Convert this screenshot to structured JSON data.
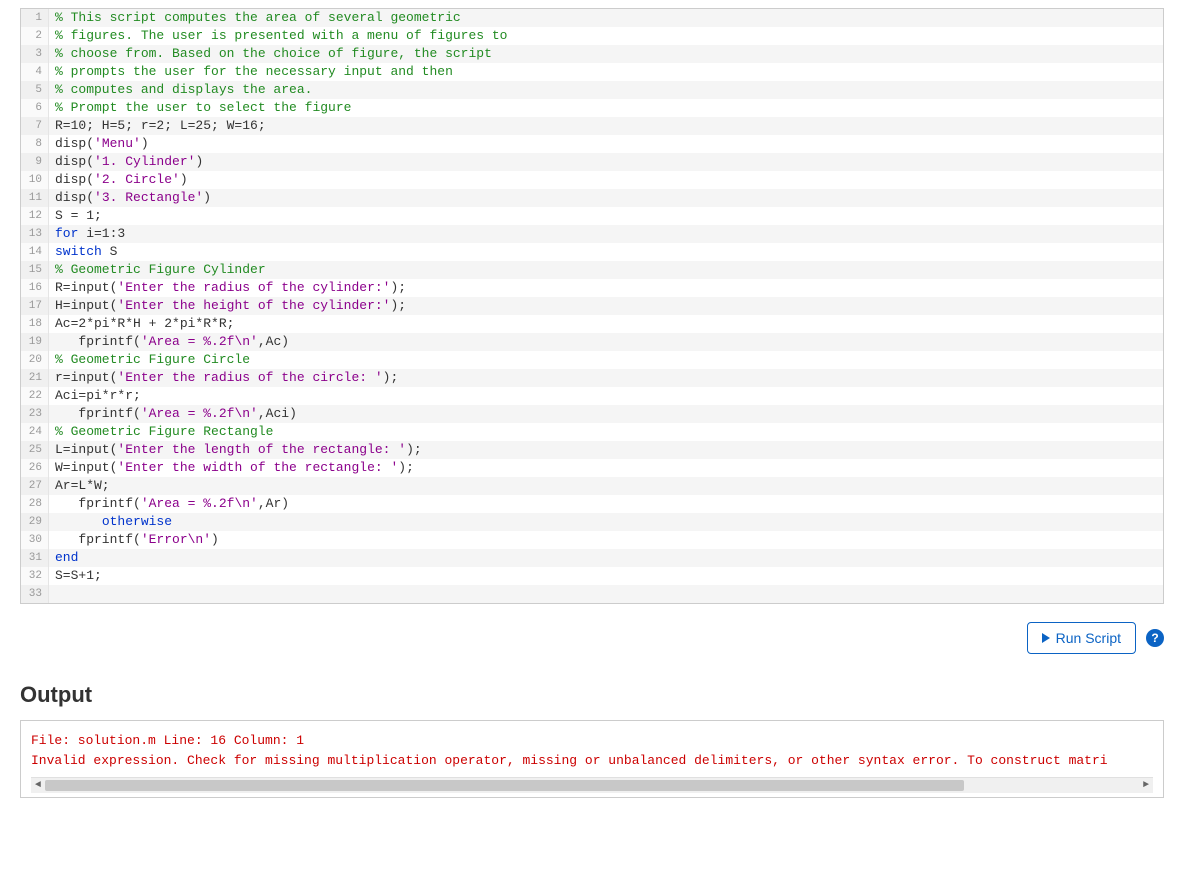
{
  "editor": {
    "lines": [
      {
        "num": 1,
        "tokens": [
          {
            "t": "comment",
            "v": "% This script computes the area of several geometric"
          }
        ]
      },
      {
        "num": 2,
        "tokens": [
          {
            "t": "comment",
            "v": "% figures. The user is presented with a menu of figures to"
          }
        ]
      },
      {
        "num": 3,
        "tokens": [
          {
            "t": "comment",
            "v": "% choose from. Based on the choice of figure, the script"
          }
        ]
      },
      {
        "num": 4,
        "tokens": [
          {
            "t": "comment",
            "v": "% prompts the user for the necessary input and then"
          }
        ]
      },
      {
        "num": 5,
        "tokens": [
          {
            "t": "comment",
            "v": "% computes and displays the area."
          }
        ]
      },
      {
        "num": 6,
        "tokens": [
          {
            "t": "comment",
            "v": "% Prompt the user to select the figure"
          }
        ]
      },
      {
        "num": 7,
        "tokens": [
          {
            "t": "plain",
            "v": "R=10; H=5; r=2; L=25; W=16;"
          }
        ]
      },
      {
        "num": 8,
        "tokens": [
          {
            "t": "plain",
            "v": "disp("
          },
          {
            "t": "string",
            "v": "'Menu'"
          },
          {
            "t": "plain",
            "v": ")"
          }
        ]
      },
      {
        "num": 9,
        "tokens": [
          {
            "t": "plain",
            "v": "disp("
          },
          {
            "t": "string",
            "v": "'1. Cylinder'"
          },
          {
            "t": "plain",
            "v": ")"
          }
        ]
      },
      {
        "num": 10,
        "tokens": [
          {
            "t": "plain",
            "v": "disp("
          },
          {
            "t": "string",
            "v": "'2. Circle'"
          },
          {
            "t": "plain",
            "v": ")"
          }
        ]
      },
      {
        "num": 11,
        "tokens": [
          {
            "t": "plain",
            "v": "disp("
          },
          {
            "t": "string",
            "v": "'3. Rectangle'"
          },
          {
            "t": "plain",
            "v": ")"
          }
        ]
      },
      {
        "num": 12,
        "tokens": [
          {
            "t": "plain",
            "v": "S = 1;"
          }
        ]
      },
      {
        "num": 13,
        "tokens": [
          {
            "t": "keyword",
            "v": "for"
          },
          {
            "t": "plain",
            "v": " i=1:3"
          }
        ]
      },
      {
        "num": 14,
        "tokens": [
          {
            "t": "keyword",
            "v": "switch"
          },
          {
            "t": "plain",
            "v": " S"
          }
        ]
      },
      {
        "num": 15,
        "tokens": [
          {
            "t": "comment",
            "v": "% Geometric Figure Cylinder"
          }
        ]
      },
      {
        "num": 16,
        "tokens": [
          {
            "t": "plain",
            "v": "R=input("
          },
          {
            "t": "string",
            "v": "'Enter the radius of the cylinder:'"
          },
          {
            "t": "plain",
            "v": ");"
          }
        ]
      },
      {
        "num": 17,
        "tokens": [
          {
            "t": "plain",
            "v": "H=input("
          },
          {
            "t": "string",
            "v": "'Enter the height of the cylinder:'"
          },
          {
            "t": "plain",
            "v": ");"
          }
        ]
      },
      {
        "num": 18,
        "tokens": [
          {
            "t": "plain",
            "v": "Ac=2*pi*R*H + 2*pi*R*R;"
          }
        ]
      },
      {
        "num": 19,
        "tokens": [
          {
            "t": "plain",
            "v": "   fprintf("
          },
          {
            "t": "string",
            "v": "'Area = %.2f\\n'"
          },
          {
            "t": "plain",
            "v": ",Ac)"
          }
        ]
      },
      {
        "num": 20,
        "tokens": [
          {
            "t": "comment",
            "v": "% Geometric Figure Circle"
          }
        ]
      },
      {
        "num": 21,
        "tokens": [
          {
            "t": "plain",
            "v": "r=input("
          },
          {
            "t": "string",
            "v": "'Enter the radius of the circle: '"
          },
          {
            "t": "plain",
            "v": ");"
          }
        ]
      },
      {
        "num": 22,
        "tokens": [
          {
            "t": "plain",
            "v": "Aci=pi*r*r;"
          }
        ]
      },
      {
        "num": 23,
        "tokens": [
          {
            "t": "plain",
            "v": "   fprintf("
          },
          {
            "t": "string",
            "v": "'Area = %.2f\\n'"
          },
          {
            "t": "plain",
            "v": ",Aci)"
          }
        ]
      },
      {
        "num": 24,
        "tokens": [
          {
            "t": "comment",
            "v": "% Geometric Figure Rectangle"
          }
        ]
      },
      {
        "num": 25,
        "tokens": [
          {
            "t": "plain",
            "v": "L=input("
          },
          {
            "t": "string",
            "v": "'Enter the length of the rectangle: '"
          },
          {
            "t": "plain",
            "v": ");"
          }
        ]
      },
      {
        "num": 26,
        "tokens": [
          {
            "t": "plain",
            "v": "W=input("
          },
          {
            "t": "string",
            "v": "'Enter the width of the rectangle: '"
          },
          {
            "t": "plain",
            "v": ");"
          }
        ]
      },
      {
        "num": 27,
        "tokens": [
          {
            "t": "plain",
            "v": "Ar=L*W;"
          }
        ]
      },
      {
        "num": 28,
        "tokens": [
          {
            "t": "plain",
            "v": "   fprintf("
          },
          {
            "t": "string",
            "v": "'Area = %.2f\\n'"
          },
          {
            "t": "plain",
            "v": ",Ar)"
          }
        ]
      },
      {
        "num": 29,
        "tokens": [
          {
            "t": "plain",
            "v": "      "
          },
          {
            "t": "keyword",
            "v": "otherwise"
          }
        ]
      },
      {
        "num": 30,
        "tokens": [
          {
            "t": "plain",
            "v": "   fprintf("
          },
          {
            "t": "string",
            "v": "'Error\\n'"
          },
          {
            "t": "plain",
            "v": ")"
          }
        ]
      },
      {
        "num": 31,
        "tokens": [
          {
            "t": "keyword",
            "v": "end"
          }
        ]
      },
      {
        "num": 32,
        "tokens": [
          {
            "t": "plain",
            "v": "S=S+1;"
          }
        ]
      },
      {
        "num": 33,
        "tokens": [
          {
            "t": "plain",
            "v": ""
          }
        ]
      }
    ]
  },
  "toolbar": {
    "run_label": "Run Script",
    "help_glyph": "?"
  },
  "output": {
    "heading": "Output",
    "lines": [
      "File: solution.m Line: 16 Column: 1",
      "Invalid expression. Check for missing multiplication operator, missing or unbalanced delimiters, or other syntax error. To construct matri"
    ]
  }
}
